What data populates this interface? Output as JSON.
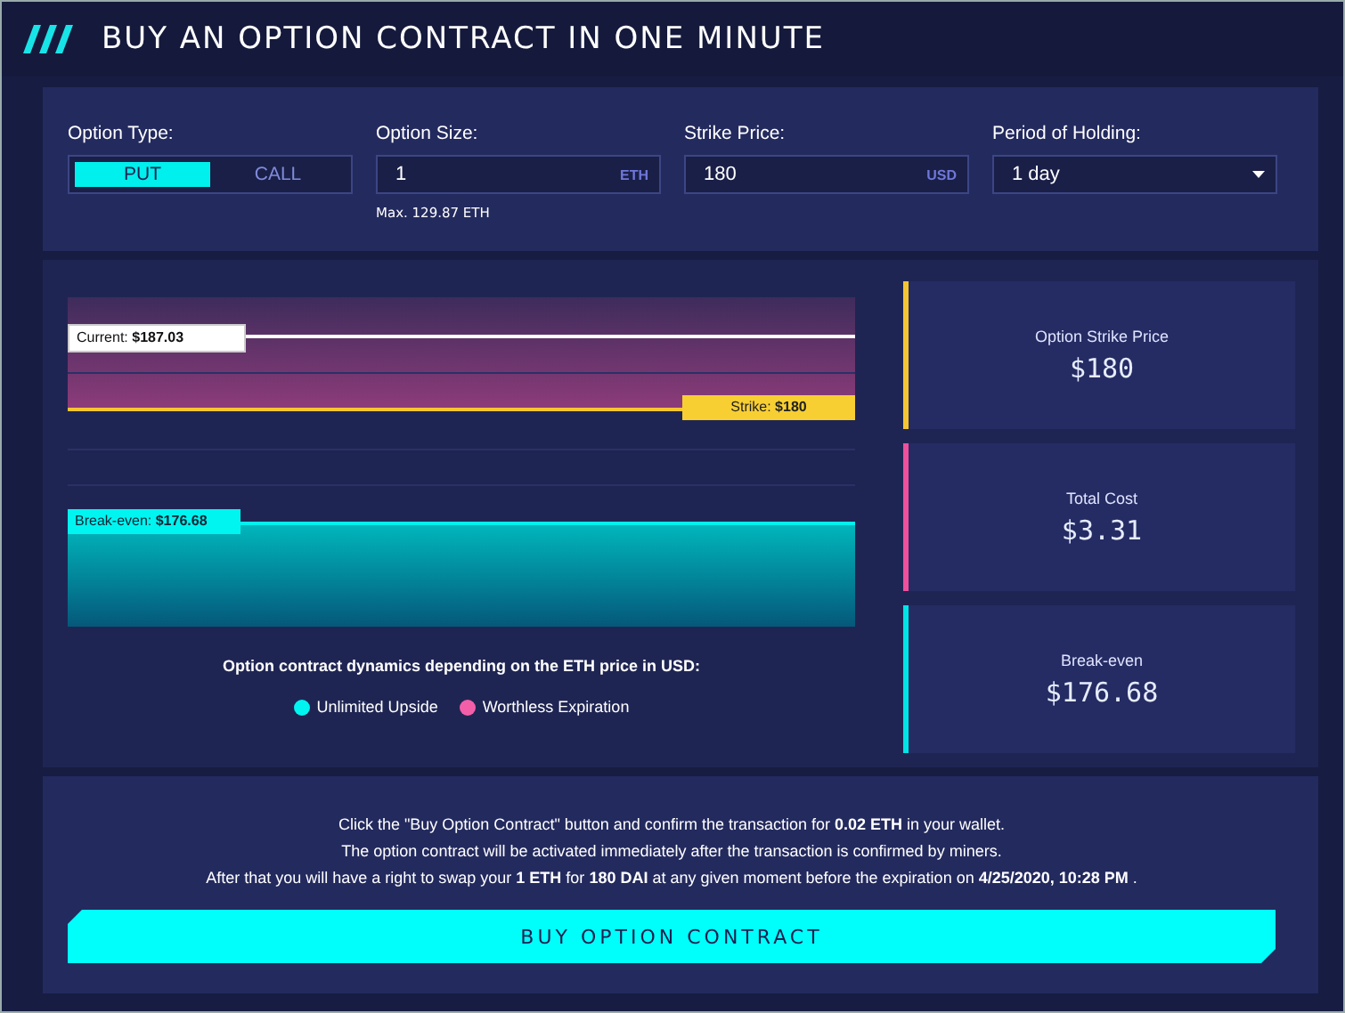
{
  "title": "BUY AN OPTION CONTRACT IN ONE MINUTE",
  "form": {
    "option_type": {
      "label": "Option Type:",
      "options": [
        {
          "label": "PUT",
          "selected": true
        },
        {
          "label": "CALL",
          "selected": false
        }
      ]
    },
    "option_size": {
      "label": "Option Size:",
      "value": "1",
      "unit": "ETH",
      "hint": "Max. 129.87 ETH"
    },
    "strike_price": {
      "label": "Strike Price:",
      "value": "180",
      "unit": "USD"
    },
    "period": {
      "label": "Period of Holding:",
      "value": "1 day"
    }
  },
  "chart": {
    "current": "Current: **$187.03**",
    "strike": "Strike: **$180**",
    "break_even": "Break-even: **$176.68**",
    "caption": "Option contract dynamics depending on the ETH price in USD:",
    "legend": [
      {
        "label": "Unlimited Upside",
        "color": "#00f5f0"
      },
      {
        "label": "Worthless Expiration",
        "color": "#f25fa8"
      }
    ]
  },
  "cards": [
    {
      "label": "Option Strike Price",
      "value": "$180",
      "color": "#f5c531"
    },
    {
      "label": "Total Cost",
      "value": "$3.31",
      "color": "#f0509b"
    },
    {
      "label": "Break-even",
      "value": "$176.68",
      "color": "#00e5e5"
    }
  ],
  "footer": {
    "lines": [
      "Click the \"Buy Option Contract\" button and confirm the transaction for **0.02 ETH** in your wallet.",
      "The option contract will be activated immediately after the transaction is confirmed by miners.",
      "After that you will have a right to swap your **1 ETH** for **180 DAI** at any given moment before the expiration on **4/25/2020, 10:28 PM** ."
    ],
    "button": "BUY OPTION CONTRACT"
  }
}
